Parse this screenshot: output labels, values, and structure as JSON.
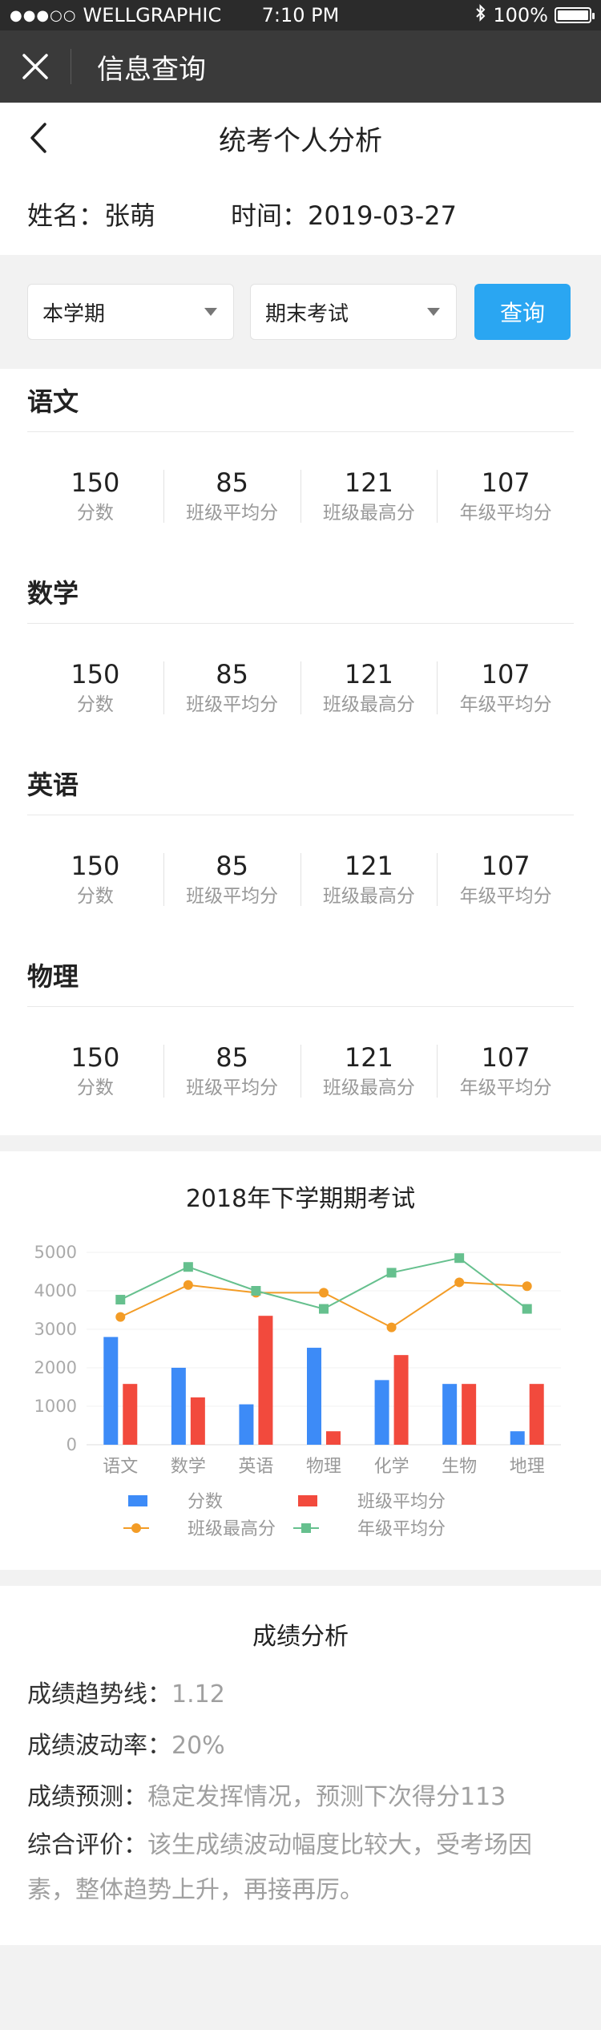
{
  "status": {
    "carrier": "WELLGRAPHIC",
    "time": "7:10 PM",
    "battery": "100%"
  },
  "appbar": {
    "title": "信息查询"
  },
  "page": {
    "title": "统考个人分析"
  },
  "info": {
    "name": "姓名：张萌",
    "date": "时间：2019-03-27"
  },
  "filters": {
    "term": "本学期",
    "exam": "期末考试",
    "query": "查询"
  },
  "stat_labels": [
    "分数",
    "班级平均分",
    "班级最高分",
    "年级平均分"
  ],
  "subjects": [
    {
      "name": "语文",
      "values": [
        "150",
        "85",
        "121",
        "107"
      ]
    },
    {
      "name": "数学",
      "values": [
        "150",
        "85",
        "121",
        "107"
      ]
    },
    {
      "name": "英语",
      "values": [
        "150",
        "85",
        "121",
        "107"
      ]
    },
    {
      "name": "物理",
      "values": [
        "150",
        "85",
        "121",
        "107"
      ]
    }
  ],
  "chart_data": {
    "type": "bar",
    "title": "2018年下学期期考试",
    "categories": [
      "语文",
      "数学",
      "英语",
      "物理",
      "化学",
      "生物",
      "地理"
    ],
    "ylim": [
      0,
      5000
    ],
    "yticks": [
      0,
      1000,
      2000,
      3000,
      4000,
      5000
    ],
    "grid": true,
    "legend_position": "bottom",
    "series": [
      {
        "name": "分数",
        "kind": "bar",
        "color": "#3d8bf7",
        "values": [
          2800,
          2000,
          1050,
          2520,
          1680,
          1580,
          350
        ]
      },
      {
        "name": "班级平均分",
        "kind": "bar",
        "color": "#f24a3d",
        "values": [
          1580,
          1230,
          3350,
          350,
          2330,
          1580,
          1580
        ]
      },
      {
        "name": "班级最高分",
        "kind": "line",
        "color": "#f39c26",
        "values": [
          3320,
          4150,
          3950,
          3950,
          3050,
          4220,
          4120
        ]
      },
      {
        "name": "年级平均分",
        "kind": "line",
        "color": "#66c08e",
        "values": [
          3770,
          4620,
          4000,
          3530,
          4470,
          4850,
          3530
        ]
      }
    ]
  },
  "analysis": {
    "title": "成绩分析",
    "trend_label": "成绩趋势线：",
    "trend_value": "1.12",
    "volatility_label": "成绩波动率：",
    "volatility_value": "20%",
    "prediction_label": "成绩预测：",
    "prediction_value": "稳定发挥情况，预测下次得分113",
    "remark_label": "综合评价：",
    "remark_value": "该生成绩波动幅度比较大，受考场因素，整体趋势上升，再接再厉。"
  }
}
